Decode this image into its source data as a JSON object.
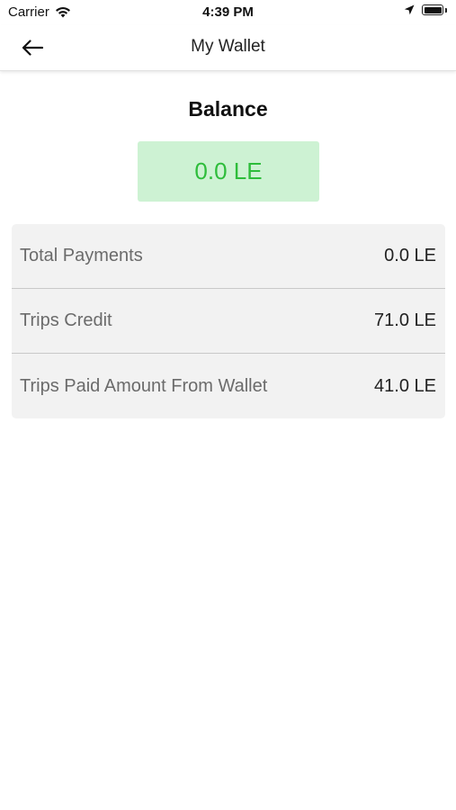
{
  "status_bar": {
    "carrier": "Carrier",
    "time": "4:39 PM",
    "icons": [
      "wifi-icon",
      "location-arrow-icon",
      "battery-icon"
    ]
  },
  "nav": {
    "title": "My Wallet",
    "back_icon": "arrow-left-icon"
  },
  "balance": {
    "title": "Balance",
    "value": "0.0 LE",
    "colors": {
      "box_background": "#cdf2d3",
      "value_text": "#2ebd3b"
    }
  },
  "summary": {
    "rows": [
      {
        "label": "Total Payments",
        "value": "0.0 LE"
      },
      {
        "label": "Trips Credit",
        "value": "71.0 LE"
      },
      {
        "label": "Trips Paid Amount From Wallet",
        "value": "41.0 LE"
      }
    ]
  }
}
